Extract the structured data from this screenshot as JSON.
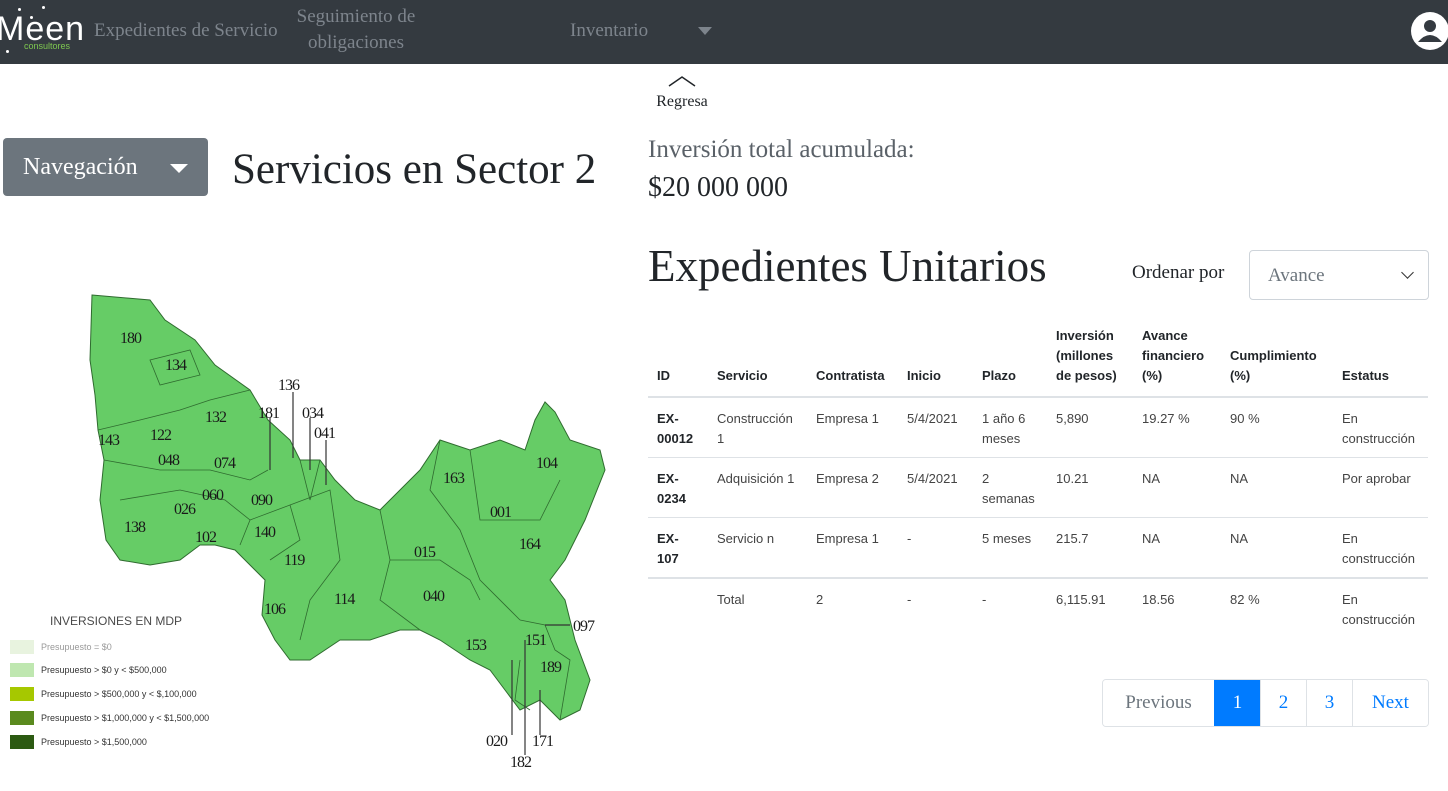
{
  "navbar": {
    "logo_text": "Meen",
    "logo_subtext": "consultores",
    "links": {
      "expedientes": "Expedientes de Servicio",
      "seguimiento": "Seguimiento de obligaciones",
      "inventario": "Inventario"
    },
    "icons": {
      "inventario_caret": "chevron-down-icon",
      "user": "user-icon"
    },
    "colors": {
      "bar": "#343a40",
      "link": "#7d848c"
    }
  },
  "back": {
    "label": "Regresa",
    "icon": "chevron-up-icon"
  },
  "sidebar": {
    "dropdown_label": "Navegación"
  },
  "page_title": "Servicios en Sector 2",
  "map": {
    "region_labels": [
      "180",
      "134",
      "136",
      "181",
      "034",
      "041",
      "132",
      "143",
      "122",
      "048",
      "074",
      "090",
      "060",
      "026",
      "138",
      "102",
      "140",
      "119",
      "163",
      "104",
      "001",
      "164",
      "015",
      "040",
      "114",
      "106",
      "153",
      "151",
      "097",
      "189",
      "020",
      "171",
      "182"
    ],
    "legend": {
      "title": "INVERSIONES EN MDP",
      "items": [
        {
          "label": "Presupuesto = $0",
          "color": "#e8f3df"
        },
        {
          "label": "Presupuesto > $0 y < $500,000",
          "color": "#bfe7b0"
        },
        {
          "label": "Presupuesto > $500,000 y < $,100,000",
          "color": "#a6c800"
        },
        {
          "label": "Presupuesto > $1,000,000 y < $1,500,000",
          "color": "#5a8a1e"
        },
        {
          "label": "Presupuesto > $1,500,000",
          "color": "#2c5a12"
        }
      ]
    },
    "region_color": "#66cc66"
  },
  "investment": {
    "label": "Inversión total acumulada:",
    "amount": "$20 000 000"
  },
  "expedientes": {
    "title": "Expedientes Unitarios",
    "order_label": "Ordenar por",
    "order_value": "Avance",
    "columns": [
      "ID",
      "Servicio",
      "Contratista",
      "Inicio",
      "Plazo",
      "Inversión (millones de pesos)",
      "Avance financiero (%)",
      "Cumplimiento (%)",
      "Estatus"
    ],
    "rows": [
      [
        "EX-00012",
        "Construcción 1",
        "Empresa 1",
        "5/4/2021",
        "1 año 6 meses",
        "5,890",
        "19.27 %",
        "90 %",
        "En construcción"
      ],
      [
        "EX-0234",
        "Adquisición 1",
        "Empresa 2",
        "5/4/2021",
        "2 semanas",
        "10.21",
        "NA",
        "NA",
        "Por aprobar"
      ],
      [
        "EX-107",
        "Servicio n",
        "Empresa 1",
        "-",
        "5 meses",
        "215.7",
        "NA",
        "NA",
        "En construcción"
      ],
      [
        "",
        "Total",
        "2",
        "-",
        "-",
        "6,115.91",
        "18.56",
        "82 %",
        "En construcción"
      ]
    ]
  },
  "pagination": {
    "previous": "Previous",
    "pages": [
      "1",
      "2",
      "3"
    ],
    "current": "1",
    "next": "Next",
    "accent": "#007bff"
  }
}
